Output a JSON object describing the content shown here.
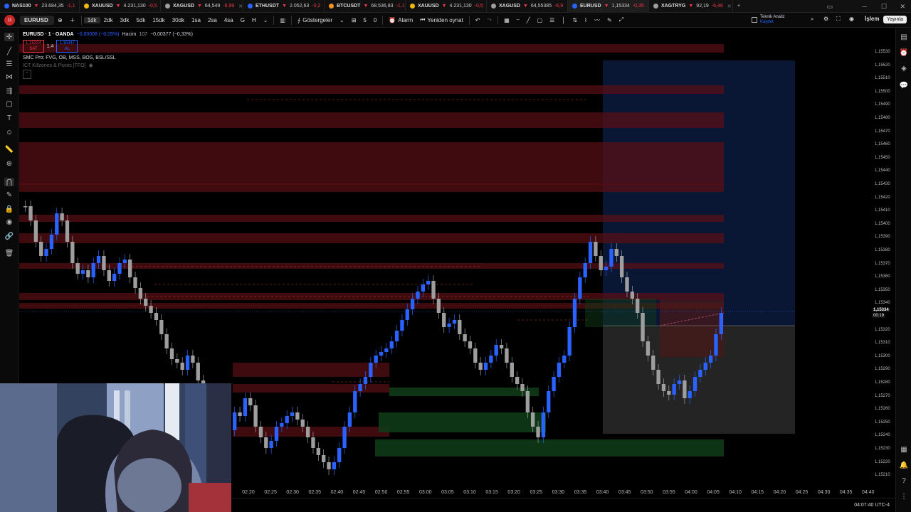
{
  "tabs": [
    {
      "symbol": "NAS100",
      "price": "23.684,35",
      "change": "-1,1",
      "color": "#2962ff"
    },
    {
      "symbol": "XAUUSD",
      "price": "4.231,130",
      "change": "-0,5",
      "color": "#f0b90b"
    },
    {
      "symbol": "XAGUSD",
      "price": "64,549",
      "change": "-6,99",
      "color": "#9e9e9e"
    },
    {
      "symbol": "ETHUSDT",
      "price": "2.052,63",
      "change": "-0,2",
      "color": "#2962ff"
    },
    {
      "symbol": "BTCUSDT",
      "price": "68.536,83",
      "change": "-1,1",
      "color": "#f7931a"
    },
    {
      "symbol": "XAUUSD",
      "price": "4.231,130",
      "change": "-0,5",
      "color": "#f0b90b"
    },
    {
      "symbol": "XAGUSD",
      "price": "64,55385",
      "change": "-6,9",
      "color": "#9e9e9e"
    },
    {
      "symbol": "EURUSD",
      "price": "1,15334",
      "change": "-0,35",
      "color": "#2962ff",
      "active": true
    },
    {
      "symbol": "XAGTRYG",
      "price": "92,19",
      "change": "-6,48",
      "color": "#9e9e9e"
    }
  ],
  "toolbar": {
    "avatar_badge": "11",
    "symbol": "EURUSD",
    "intervals": [
      "1dk",
      "2dk",
      "3dk",
      "5dk",
      "15dk",
      "30dk",
      "1sa",
      "2sa",
      "4sa",
      "G",
      "H"
    ],
    "active_interval": "1dk",
    "indicators_label": "Göstergeler",
    "alarm_label": "Alarm",
    "replay_label": "Yeniden oynat",
    "analysis_label": "Teknik Analiz",
    "analysis_sub": "Kaydet",
    "trade_label": "İşlem",
    "publish_label": "Yayınla",
    "counts": [
      "5",
      "0"
    ]
  },
  "legend": {
    "title": "EURUSD · 1 · OANDA",
    "change": "−0,00008 (−0,05%)",
    "volume_label": "Hacim",
    "volume_value": "107",
    "extra": "−0,00377 (−0,33%)",
    "sell_price": "1,15324",
    "sell_label": "SAT",
    "spread": "1.4",
    "buy_price": "1,15347",
    "buy_label": "AL",
    "indicator1": "SMC Pro: FVG, OB, MSS, BOS, BSL/SSL",
    "indicator2": "ICT Killzones & Pivots [TFO]"
  },
  "price_axis": {
    "labels": [
      "1,15530",
      "1,15520",
      "1,15510",
      "1,15500",
      "1,15490",
      "1,15480",
      "1,15470",
      "1,15460",
      "1,15450",
      "1,15440",
      "1,15430",
      "1,15420",
      "1,15410",
      "1,15400",
      "1,15390",
      "1,15380",
      "1,15370",
      "1,15360",
      "1,15350",
      "1,15340",
      "1,15320",
      "1,15310",
      "1,15300",
      "1,15290",
      "1,15280",
      "1,15270",
      "1,15260",
      "1,15250",
      "1,15240",
      "1,15230",
      "1,15220",
      "1,15210"
    ],
    "current_price": "1,15334",
    "countdown": "00:19"
  },
  "time_axis": [
    "02:20",
    "02:25",
    "02:30",
    "02:35",
    "02:40",
    "02:45",
    "02:50",
    "02:55",
    "03:00",
    "03:05",
    "03:10",
    "03:15",
    "03:20",
    "03:25",
    "03:30",
    "03:35",
    "03:40",
    "03:45",
    "03:50",
    "03:55",
    "04:00",
    "04:05",
    "04:10",
    "04:15",
    "04:20",
    "04:25",
    "04:30",
    "04:35",
    "04:40"
  ],
  "status": {
    "clock": "04:07:40 UTC-4"
  },
  "colors": {
    "bull": "#2962ff",
    "bear": "#9e9e9e",
    "zone_red": "#5a1014",
    "zone_green": "#0f3a18",
    "target_blue": "#0b1a3a",
    "stop_gray": "#2a2a2a"
  }
}
